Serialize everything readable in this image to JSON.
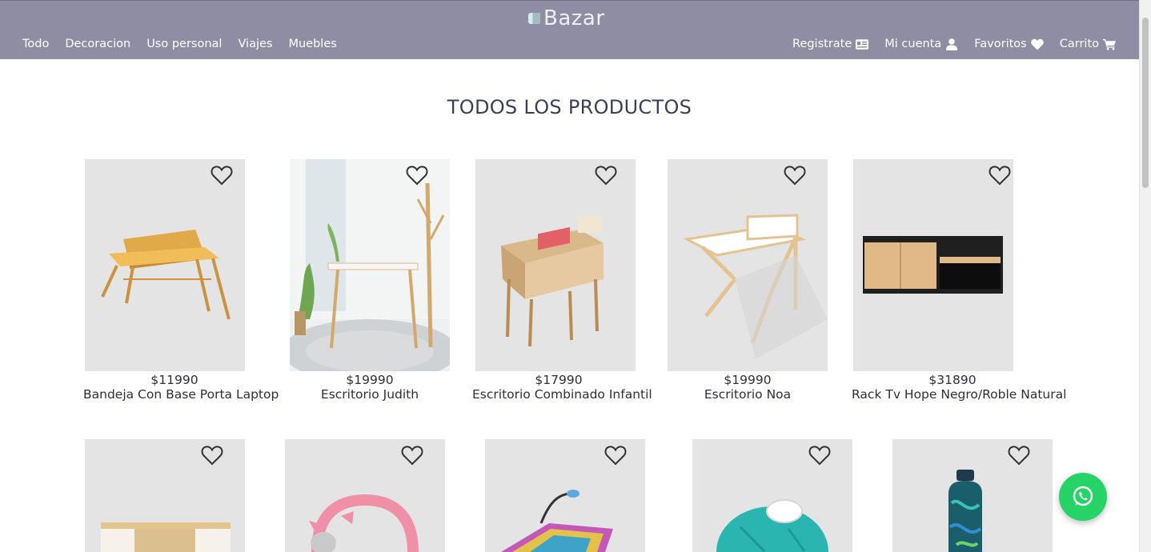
{
  "header": {
    "brand": "Bazar",
    "nav_left": [
      "Todo",
      "Decoracion",
      "Uso personal",
      "Viajes",
      "Muebles"
    ],
    "nav_right": [
      {
        "label": "Registrate",
        "icon": "id-card-icon"
      },
      {
        "label": "Mi cuenta",
        "icon": "user-icon"
      },
      {
        "label": "Favoritos",
        "icon": "heart-icon"
      },
      {
        "label": "Carrito",
        "icon": "cart-icon"
      }
    ]
  },
  "main": {
    "title": "TODOS LOS PRODUCTOS",
    "products": [
      {
        "price": "$11990",
        "name": "Bandeja Con Base Porta Laptop",
        "image": "laptop-tray"
      },
      {
        "price": "$19990",
        "name": "Escritorio Judith",
        "image": "desk-room"
      },
      {
        "price": "$17990",
        "name": "Escritorio Combinado Infantil",
        "image": "kids-desk"
      },
      {
        "price": "$19990",
        "name": "Escritorio Noa",
        "image": "white-desk"
      },
      {
        "price": "$31890",
        "name": "Rack Tv Hope Negro/Roble Natural",
        "image": "tv-rack"
      }
    ],
    "products_row2": [
      {
        "image": "cabinet"
      },
      {
        "image": "cat-ear-headphones"
      },
      {
        "image": "lap-tray-lamp"
      },
      {
        "image": "ice-bag"
      },
      {
        "image": "water-bottle"
      }
    ]
  },
  "whatsapp": {
    "icon": "whatsapp-icon"
  },
  "colors": {
    "navbar": "#8e8da4",
    "card_bg": "#e4e4e4",
    "whatsapp": "#25d366",
    "title": "#3b3f5c"
  }
}
